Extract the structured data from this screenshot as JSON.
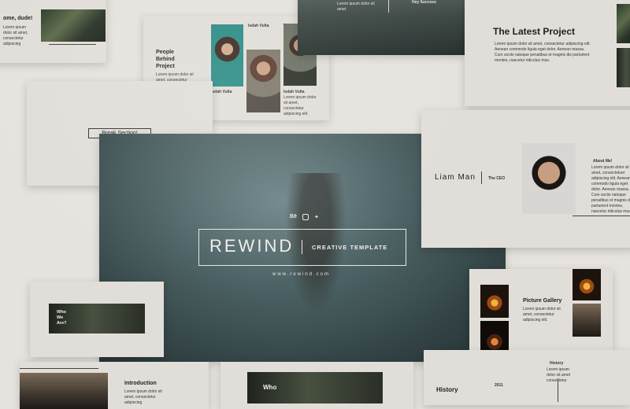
{
  "hero": {
    "brand": "REWIND",
    "tagline": "CREATIVE TEMPLATE",
    "url": "www.rewind.com",
    "social_icons": [
      "behance-icon",
      "instagram-icon",
      "twitter-icon"
    ]
  },
  "slides": {
    "welcome": {
      "heading": "ome, dude!",
      "body": "Lorem ipsum dolor sit amet, consectetur adipiscing"
    },
    "people": {
      "heading": "People Behind Project",
      "body": "Lorem ipsum dolor sit amet, consectetur adipiscing elit.",
      "person1_label": "Isdah Vulta",
      "person2_label": "Isdah Vulta",
      "person3_label": "Isdah Vulta",
      "person4_label": "Isdah Vulta",
      "caption": "Lorem ipsum dolor sit amet, consectetur adipiscing elit."
    },
    "sea": {
      "caption": "Lorem ipsum dolor sit amet",
      "label": "Hey Success"
    },
    "latest": {
      "heading": "The Latest Project",
      "body": "Lorem ipsum dolor sit amet, consectetur adipiscing elit. Aenean commodo ligula eget dolor. Aenean massa. Cum sociis natoque penatibus et magnis dis parturient montes, nascetur ridiculus mus."
    },
    "break": {
      "label": "Break Section!"
    },
    "ceo": {
      "name": "Liam Man",
      "role": "The CEO",
      "about_heading": "About Me!",
      "about_body": "Lorem ipsum dolor sit amet, consectetuer adipiscing elit. Aenean commodo ligula eget dolor. Aenean massa. Cum sociis natoque penatibus et magnis dis parturient montes, nascetur ridiculus mus."
    },
    "who": {
      "label": "Who We Are?"
    },
    "gallery": {
      "heading": "Picture Gallery",
      "body": "Lorem ipsum dolor sit amet, consectetur adipiscing elit."
    },
    "intro": {
      "heading": "Introduction",
      "body": "Lorem ipsum dolor sit amet, consectetur adipiscing"
    },
    "who2": {
      "label": "Who"
    },
    "history": {
      "heading": "History",
      "small_label": "History",
      "year1": "2011",
      "body": "Lorem ipsum dolor sit amet consectetur"
    }
  }
}
